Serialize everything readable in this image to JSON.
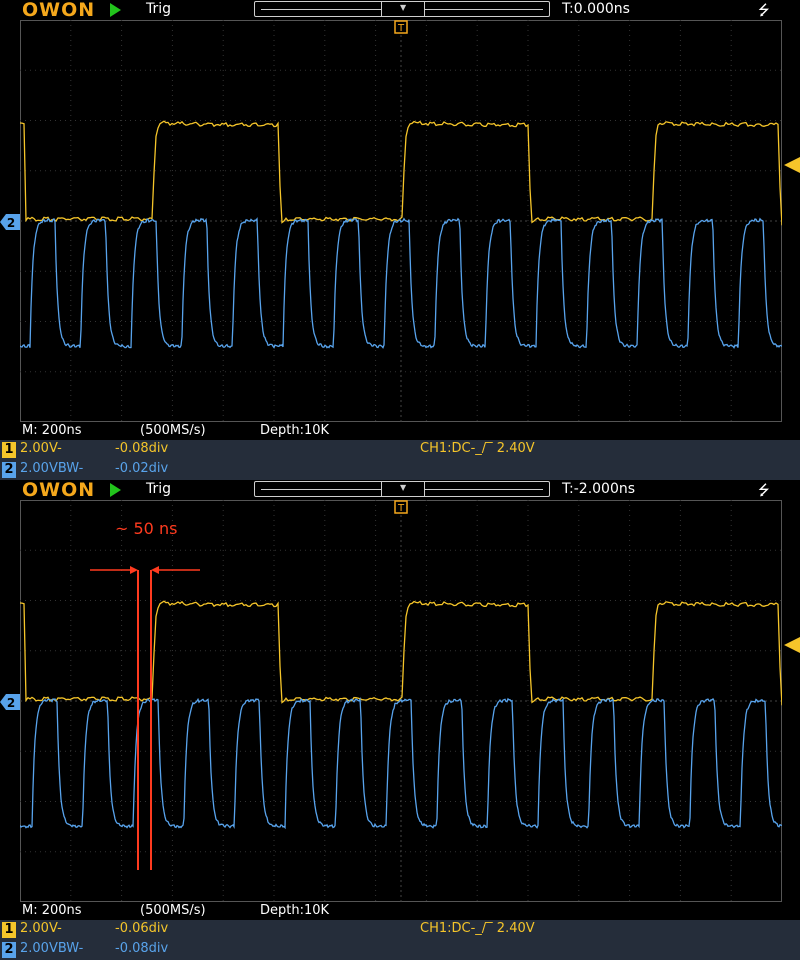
{
  "colors": {
    "ch1": "#f5c52a",
    "ch2": "#58a3ec",
    "grid": "#3a3a3a",
    "annotation": "#ff3b1f",
    "logo": "#f5a81c"
  },
  "screens": [
    {
      "logo": "OWON",
      "run_state_icon": "play-icon",
      "trig_label": "Trig",
      "trigger_time": "T:0.000ns",
      "timebase": "M: 200ns",
      "sample_rate": "(500MS/s)",
      "depth": "Depth:10K",
      "ch1": {
        "num": "1",
        "volts": "2.00V-",
        "offset": "-0.08div"
      },
      "ch2": {
        "num": "2",
        "volts": "2.00VBW-",
        "offset": "-0.02div"
      },
      "trigger_info": "CH1:DC-_/‾ 2.40V"
    },
    {
      "logo": "OWON",
      "run_state_icon": "play-icon",
      "trig_label": "Trig",
      "trigger_time": "T:-2.000ns",
      "timebase": "M: 200ns",
      "sample_rate": "(500MS/s)",
      "depth": "Depth:10K",
      "ch1": {
        "num": "1",
        "volts": "2.00V-",
        "offset": "-0.06div"
      },
      "ch2": {
        "num": "2",
        "volts": "2.00VBW-",
        "offset": "-0.08div"
      },
      "trigger_info": "CH1:DC-_/‾ 2.40V"
    }
  ],
  "annotation": {
    "label": "~ 50 ns"
  }
}
